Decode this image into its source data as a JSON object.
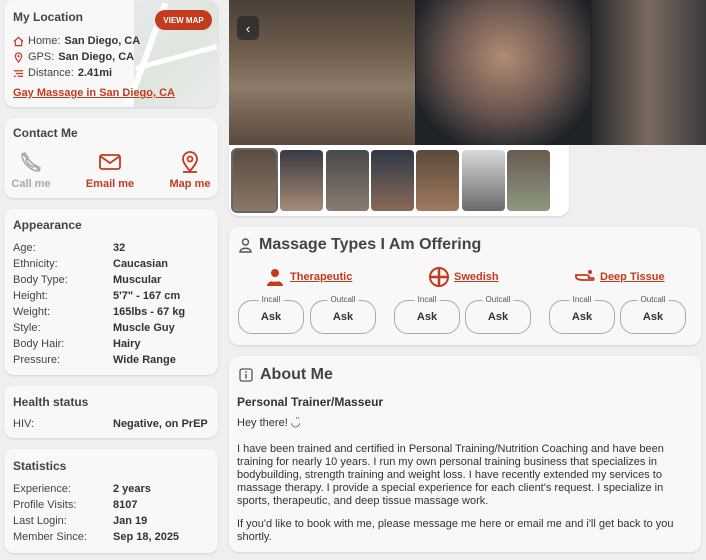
{
  "location": {
    "title": "My Location",
    "view_map": "VIEW MAP",
    "home_label": "Home:",
    "home_value": "San Diego, CA",
    "gps_label": "GPS:",
    "gps_value": "San Diego, CA",
    "distance_label": "Distance:",
    "distance_value": "2.41mi",
    "link": "Gay Massage in San Diego, CA"
  },
  "contact": {
    "title": "Contact Me",
    "call": "Call me",
    "email": "Email me",
    "map": "Map me"
  },
  "appearance": {
    "title": "Appearance",
    "rows": [
      {
        "k": "Age:",
        "v": "32"
      },
      {
        "k": "Ethnicity:",
        "v": "Caucasian"
      },
      {
        "k": "Body Type:",
        "v": "Muscular"
      },
      {
        "k": "Height:",
        "v": "5'7\" - 167 cm"
      },
      {
        "k": "Weight:",
        "v": "165lbs - 67 kg"
      },
      {
        "k": "Style:",
        "v": "Muscle Guy"
      },
      {
        "k": "Body Hair:",
        "v": "Hairy"
      },
      {
        "k": "Pressure:",
        "v": "Wide Range"
      }
    ]
  },
  "health": {
    "title": "Health status",
    "rows": [
      {
        "k": "HIV:",
        "v": "Negative, on PrEP"
      }
    ]
  },
  "statistics": {
    "title": "Statistics",
    "rows": [
      {
        "k": "Experience:",
        "v": "2 years"
      },
      {
        "k": "Profile Visits:",
        "v": "8107"
      },
      {
        "k": "Last Login:",
        "v": "Jan 19"
      },
      {
        "k": "Member Since:",
        "v": "Sep 18, 2025"
      }
    ]
  },
  "gallery": {
    "prev": "‹"
  },
  "massage": {
    "title": "Massage Types I Am Offering",
    "types": [
      {
        "name": "Therapeutic",
        "icon": "therapist-icon",
        "incall_label": "Incall",
        "incall": "Ask",
        "outcall_label": "Outcall",
        "outcall": "Ask"
      },
      {
        "name": "Swedish",
        "icon": "swedish-cross-icon",
        "incall_label": "Incall",
        "incall": "Ask",
        "outcall_label": "Outcall",
        "outcall": "Ask"
      },
      {
        "name": "Deep Tissue",
        "icon": "massage-hand-icon",
        "incall_label": "Incall",
        "incall": "Ask",
        "outcall_label": "Outcall",
        "outcall": "Ask"
      }
    ]
  },
  "about": {
    "title": "About Me",
    "subtitle": "Personal Trainer/Masseur",
    "p1": "Hey there! ◡̈",
    "p2": "I have been trained and certified in Personal Training/Nutrition Coaching and have been training for nearly 10 years. I run my own personal training business that specializes in bodybuilding, strength training and weight loss. I have recently extended my services to massage therapy. I provide a special experience for each client's request. I specialize in sports, therapeutic, and deep tissue massage work.",
    "p3": "If you'd like to book with me, please message me here or email me and i'll get back to you shortly."
  },
  "colors": {
    "accent": "#c43a1e",
    "card": "#f8f8f8",
    "page": "#efefef"
  }
}
